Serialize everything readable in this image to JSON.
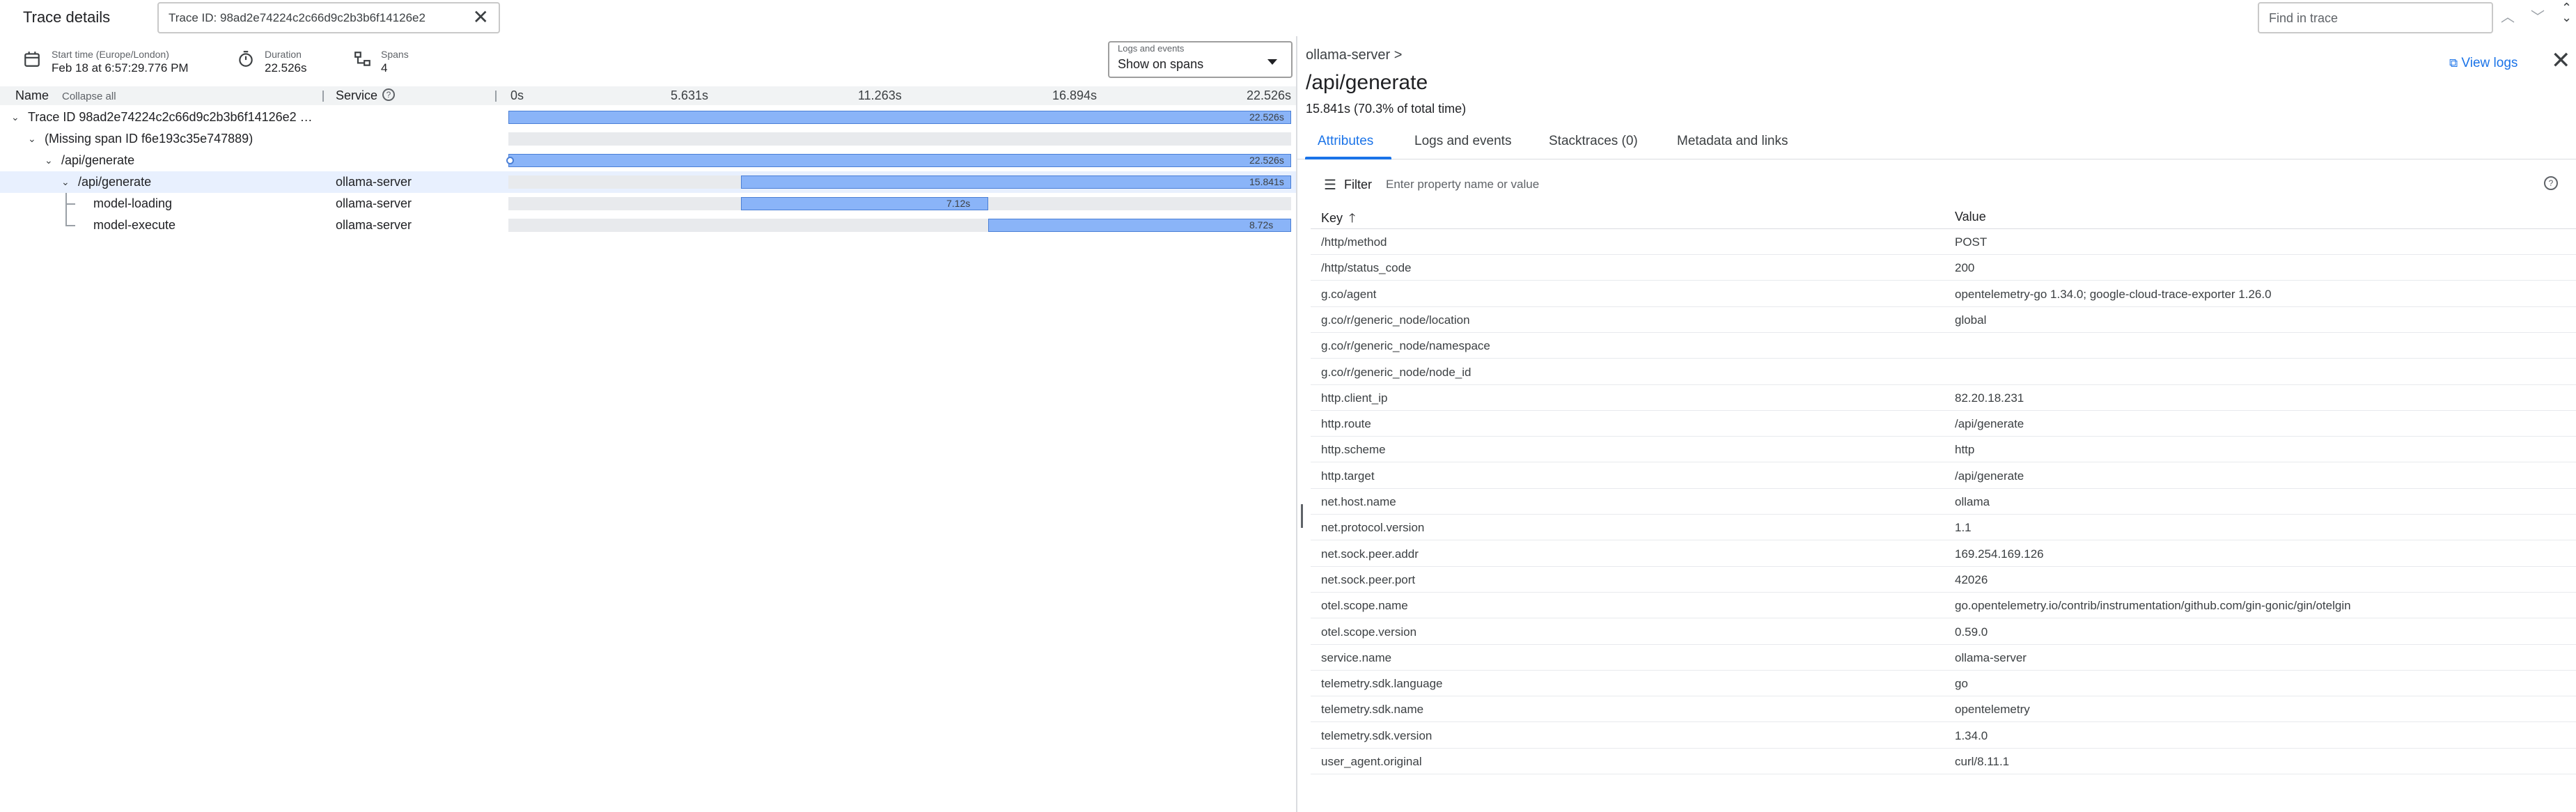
{
  "header": {
    "title": "Trace details",
    "trace_id_text": "Trace ID: 98ad2e74224c2c66d9c2b3b6f14126e2",
    "find_placeholder": "Find in trace"
  },
  "info": {
    "start_label": "Start time (Europe/London)",
    "start_value": "Feb 18 at 6:57:29.776 PM",
    "duration_label": "Duration",
    "duration_value": "22.526s",
    "spans_label": "Spans",
    "spans_value": "4"
  },
  "logs_select": {
    "label": "Logs and events",
    "value": "Show on spans"
  },
  "timeline": {
    "col_name": "Name",
    "collapse_all": "Collapse all",
    "col_service": "Service",
    "ticks": [
      "0s",
      "5.631s",
      "11.263s",
      "16.894s",
      "22.526s"
    ],
    "rows": [
      {
        "name": "Trace ID 98ad2e74224c2c66d9c2b3b6f14126e2 …",
        "service": "",
        "start": 0,
        "end": 1,
        "label": "22.526s"
      },
      {
        "name": "(Missing span ID f6e193c35e747889)",
        "service": "",
        "start": null,
        "end": null,
        "label": ""
      },
      {
        "name": "/api/generate",
        "service": "",
        "start": 0,
        "end": 1,
        "label": "22.526s"
      },
      {
        "name": "/api/generate",
        "service": "ollama-server",
        "start": 0.2968,
        "end": 1,
        "label": "15.841s"
      },
      {
        "name": "model-loading",
        "service": "ollama-server",
        "start": 0.2968,
        "end": 0.6129,
        "label": "7.12s"
      },
      {
        "name": "model-execute",
        "service": "ollama-server",
        "start": 0.6129,
        "end": 1,
        "label": "8.72s"
      }
    ]
  },
  "detail": {
    "breadcrumb": "ollama-server >",
    "title": "/api/generate",
    "subtitle": "15.841s (70.3% of total time)",
    "view_logs": "View logs",
    "tabs": [
      "Attributes",
      "Logs and events",
      "Stacktraces (0)",
      "Metadata and links"
    ],
    "filter_label": "Filter",
    "filter_placeholder": "Enter property name or value",
    "col_key": "Key",
    "col_value": "Value",
    "attributes": [
      {
        "k": "/http/method",
        "v": "POST"
      },
      {
        "k": "/http/status_code",
        "v": "200"
      },
      {
        "k": "g.co/agent",
        "v": "opentelemetry-go 1.34.0; google-cloud-trace-exporter 1.26.0"
      },
      {
        "k": "g.co/r/generic_node/location",
        "v": "global"
      },
      {
        "k": "g.co/r/generic_node/namespace",
        "v": ""
      },
      {
        "k": "g.co/r/generic_node/node_id",
        "v": ""
      },
      {
        "k": "http.client_ip",
        "v": "82.20.18.231"
      },
      {
        "k": "http.route",
        "v": "/api/generate"
      },
      {
        "k": "http.scheme",
        "v": "http"
      },
      {
        "k": "http.target",
        "v": "/api/generate"
      },
      {
        "k": "net.host.name",
        "v": "ollama"
      },
      {
        "k": "net.protocol.version",
        "v": "1.1"
      },
      {
        "k": "net.sock.peer.addr",
        "v": "169.254.169.126"
      },
      {
        "k": "net.sock.peer.port",
        "v": "42026"
      },
      {
        "k": "otel.scope.name",
        "v": "go.opentelemetry.io/contrib/instrumentation/github.com/gin-gonic/gin/otelgin"
      },
      {
        "k": "otel.scope.version",
        "v": "0.59.0"
      },
      {
        "k": "service.name",
        "v": "ollama-server"
      },
      {
        "k": "telemetry.sdk.language",
        "v": "go"
      },
      {
        "k": "telemetry.sdk.name",
        "v": "opentelemetry"
      },
      {
        "k": "telemetry.sdk.version",
        "v": "1.34.0"
      },
      {
        "k": "user_agent.original",
        "v": "curl/8.11.1"
      }
    ]
  }
}
